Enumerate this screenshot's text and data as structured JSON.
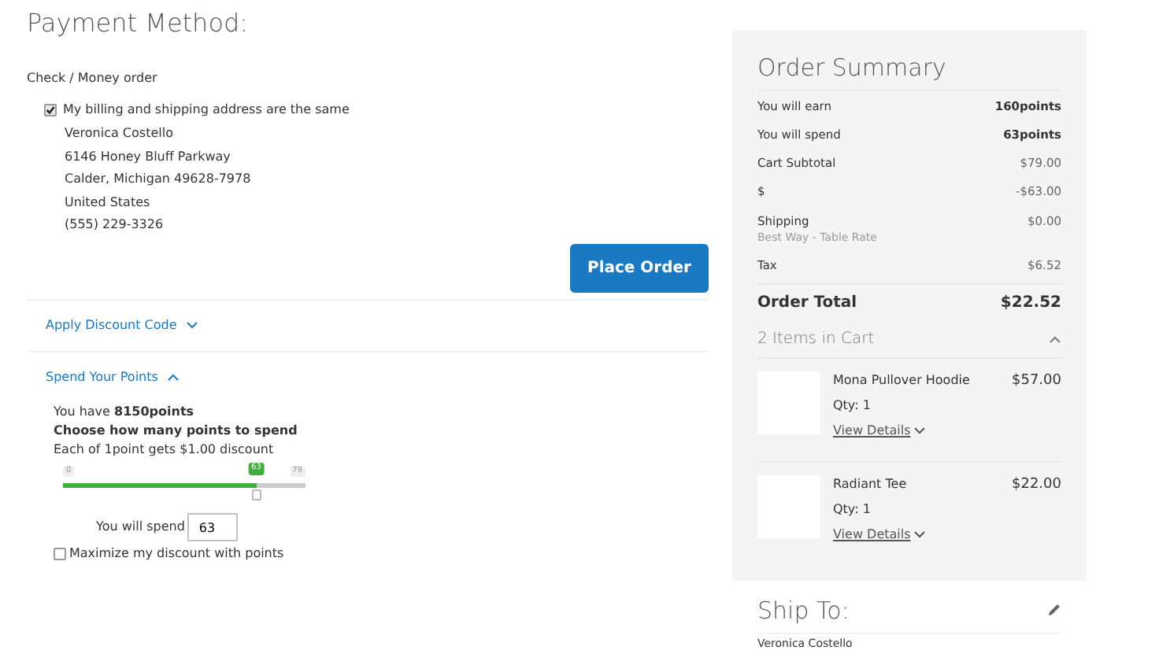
{
  "payment": {
    "title": "Payment Method:",
    "method": "Check / Money order",
    "same_address": {
      "label": "My billing and shipping address are the same",
      "checked": true
    },
    "address": [
      "Veronica Costello",
      "6146 Honey Bluff Parkway",
      "Calder, Michigan 49628-7978",
      "United States",
      "(555) 229-3326"
    ],
    "place_order": "Place Order"
  },
  "discount": {
    "label": "Apply Discount Code",
    "expanded": false
  },
  "points": {
    "label": "Spend Your Points",
    "expanded": true,
    "have": "You have **8150points**",
    "choose": "Choose how many points to spend",
    "rate": "Each of 1point gets $1.00 discount",
    "slider": {
      "min_label": "0",
      "value_label": "63",
      "max_label": "79",
      "level": 0.797
    },
    "spend": {
      "label": "You will spend",
      "value": "63"
    },
    "maximize": {
      "label": "Maximize my discount with points",
      "checked": false
    }
  },
  "summary": {
    "title": "Order Summary",
    "rows": [
      {
        "label": "You will earn",
        "value": "160points",
        "bold": true
      },
      {
        "label": "You will spend",
        "value": "63points",
        "bold": true
      },
      {
        "label": "Cart Subtotal",
        "value": "$79.00",
        "bold": false
      },
      {
        "label": "$",
        "value": "-$63.00",
        "bold": false
      },
      {
        "label": "Shipping",
        "note": "Best Way - Table Rate",
        "value": "$0.00",
        "bold": false
      },
      {
        "label": "Tax",
        "value": "$6.52",
        "bold": false
      }
    ],
    "total": {
      "label": "Order Total",
      "value": "$22.52"
    },
    "cart": {
      "title": "2 Items in Cart",
      "expanded": true,
      "items": [
        {
          "name": "Mona Pullover Hoodie",
          "qty": "Qty: 1",
          "details": "View Details",
          "price": "$57.00"
        },
        {
          "name": "Radiant Tee",
          "qty": "Qty: 1",
          "details": "View Details",
          "price": "$22.00"
        }
      ]
    }
  },
  "ship_to": {
    "title": "Ship To:",
    "lines": [
      "Veronica Costello"
    ]
  }
}
